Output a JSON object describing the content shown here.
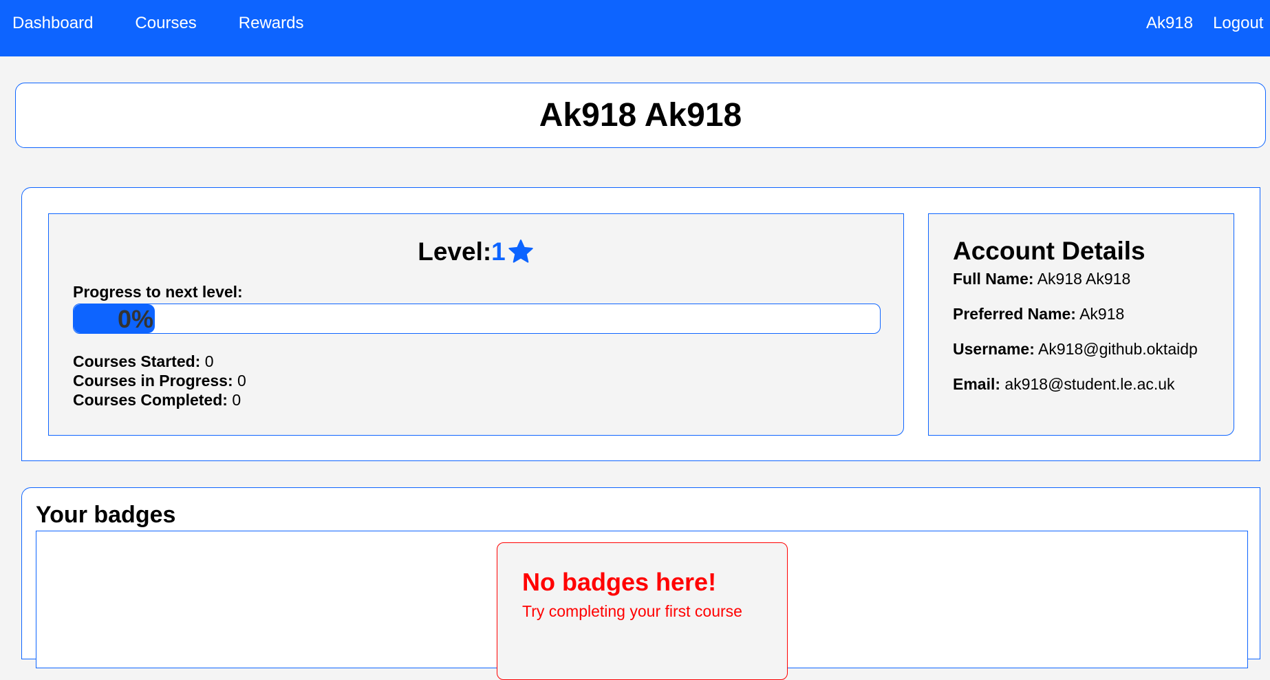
{
  "nav": {
    "links": [
      {
        "label": "Dashboard"
      },
      {
        "label": "Courses"
      },
      {
        "label": "Rewards"
      }
    ],
    "user": "Ak918",
    "logout": "Logout"
  },
  "profile": {
    "display_name": "Ak918 Ak918"
  },
  "level": {
    "label": "Level: ",
    "value": "1",
    "star_icon": "star-icon",
    "progress_label": "Progress to next level:",
    "progress_percent": 0,
    "progress_text": "0%"
  },
  "stats": {
    "started_label": "Courses Started:",
    "started_value": "0",
    "in_progress_label": "Courses in Progress:",
    "in_progress_value": "0",
    "completed_label": "Courses Completed:",
    "completed_value": "0"
  },
  "account": {
    "title": "Account Details",
    "full_name_label": "Full Name:",
    "full_name": "Ak918 Ak918",
    "preferred_name_label": "Preferred Name:",
    "preferred_name": "Ak918",
    "username_label": "Username:",
    "username": "Ak918@github.oktaidp",
    "email_label": "Email:",
    "email": "ak918@student.le.ac.uk"
  },
  "badges": {
    "title": "Your badges",
    "empty_title": "No badges here!",
    "empty_subtitle": "Try completing your first course"
  },
  "colors": {
    "primary": "#0d64ff",
    "background": "#f4f4f4",
    "empty_state": "#ff0000"
  }
}
